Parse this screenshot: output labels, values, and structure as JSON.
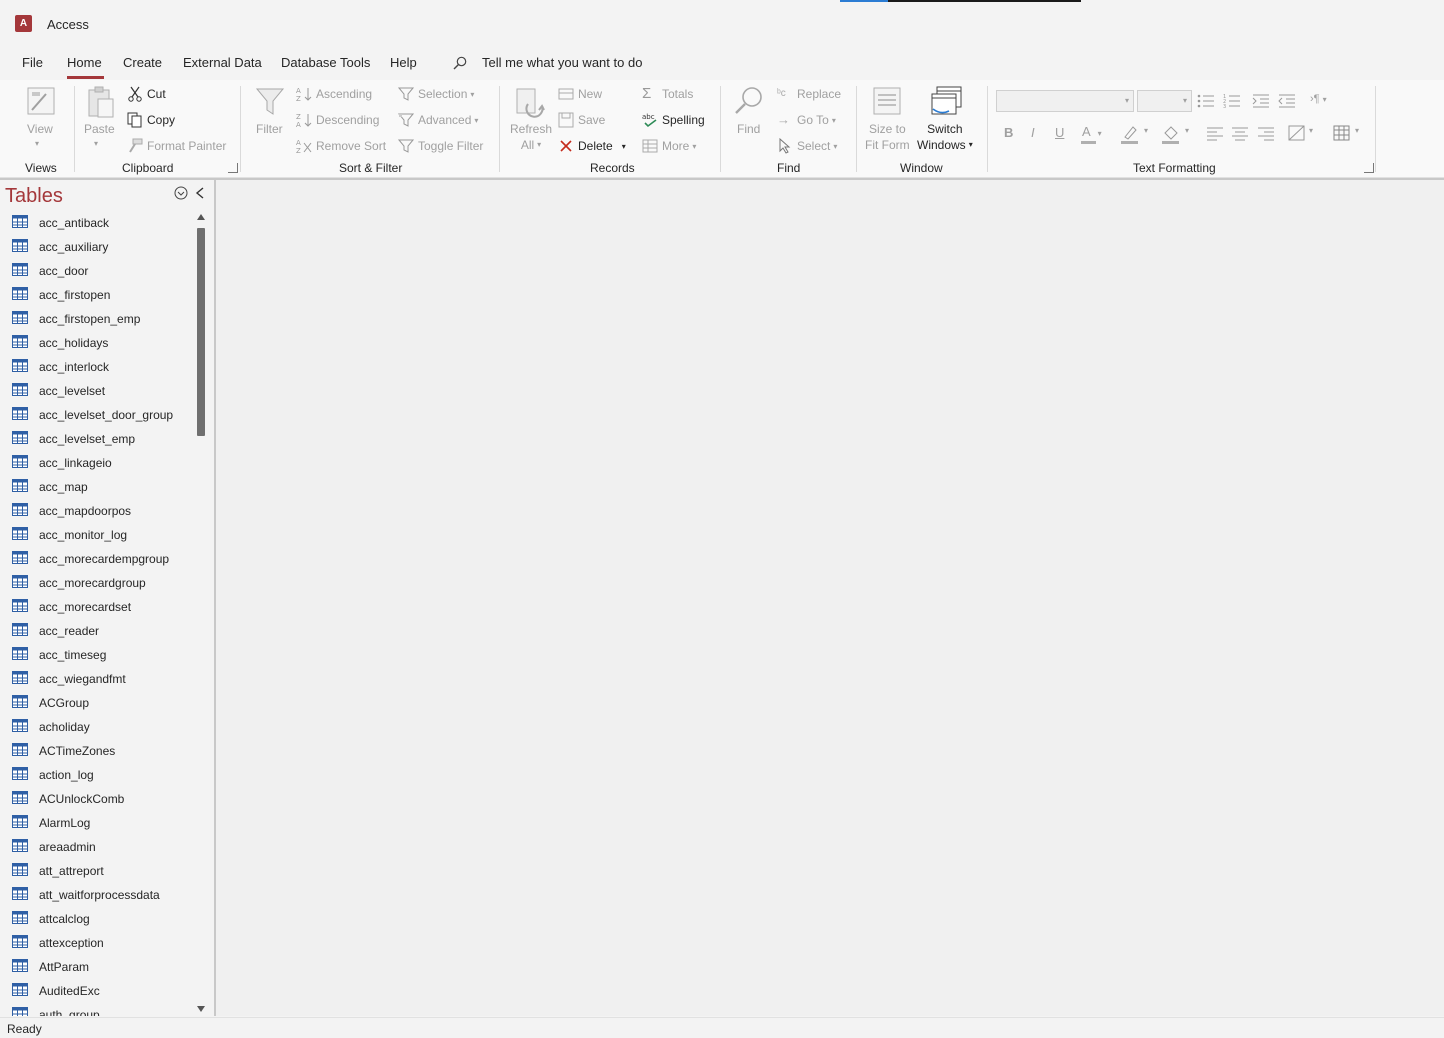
{
  "app": {
    "title": "Access",
    "logo_letter": "A"
  },
  "menu": {
    "tabs": [
      "File",
      "Home",
      "Create",
      "External Data",
      "Database Tools",
      "Help"
    ],
    "active_tab": "Home",
    "tell_me": "Tell me what you want to do"
  },
  "ribbon": {
    "views": {
      "label": "Views",
      "view_button": "View"
    },
    "clipboard": {
      "label": "Clipboard",
      "paste": "Paste",
      "cut": "Cut",
      "copy": "Copy",
      "format_painter": "Format Painter"
    },
    "sort_filter": {
      "label": "Sort & Filter",
      "filter": "Filter",
      "ascending": "Ascending",
      "descending": "Descending",
      "remove_sort": "Remove Sort",
      "selection": "Selection",
      "advanced": "Advanced",
      "toggle_filter": "Toggle Filter"
    },
    "records": {
      "label": "Records",
      "refresh_line1": "Refresh",
      "refresh_line2": "All",
      "new": "New",
      "save": "Save",
      "delete": "Delete",
      "totals": "Totals",
      "spelling": "Spelling",
      "more": "More"
    },
    "find": {
      "label": "Find",
      "find": "Find",
      "replace": "Replace",
      "go_to": "Go To",
      "select": "Select"
    },
    "window": {
      "label": "Window",
      "size_to_fit_line1": "Size to",
      "size_to_fit_line2": "Fit Form",
      "switch_windows_line1": "Switch",
      "switch_windows_line2": "Windows"
    },
    "text_formatting": {
      "label": "Text Formatting",
      "bold": "B",
      "italic": "I",
      "underline": "U",
      "font_color_letter": "A"
    }
  },
  "nav_pane": {
    "title": "Tables",
    "items": [
      "acc_antiback",
      "acc_auxiliary",
      "acc_door",
      "acc_firstopen",
      "acc_firstopen_emp",
      "acc_holidays",
      "acc_interlock",
      "acc_levelset",
      "acc_levelset_door_group",
      "acc_levelset_emp",
      "acc_linkageio",
      "acc_map",
      "acc_mapdoorpos",
      "acc_monitor_log",
      "acc_morecardempgroup",
      "acc_morecardgroup",
      "acc_morecardset",
      "acc_reader",
      "acc_timeseg",
      "acc_wiegandfmt",
      "ACGroup",
      "acholiday",
      "ACTimeZones",
      "action_log",
      "ACUnlockComb",
      "AlarmLog",
      "areaadmin",
      "att_attreport",
      "att_waitforprocessdata",
      "attcalclog",
      "attexception",
      "AttParam",
      "AuditedExc",
      "auth_group"
    ]
  },
  "status": {
    "text": "Ready"
  },
  "colors": {
    "accent": "#a4373a",
    "ribbon_bg": "#f9f9f9",
    "workspace_bg": "#f0f0f0",
    "delete_red": "#c42b1c"
  }
}
